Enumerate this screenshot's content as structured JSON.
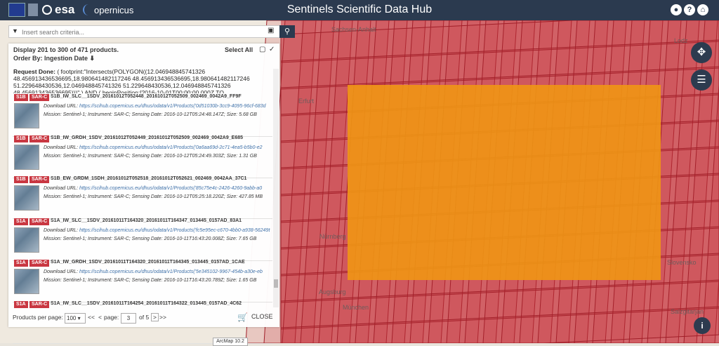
{
  "header": {
    "title": "Sentinels Scientific Data Hub",
    "esa_logo": "esa",
    "copernicus_logo": "opernicus"
  },
  "search": {
    "placeholder": "Insert search criteria..."
  },
  "panel": {
    "summary": "Display 201 to 300 of 471 products.",
    "order_by": "Order By: Ingestion Date",
    "select_all": "Select All",
    "request_label": "Request Done:",
    "request_text": "( footprint:\"Intersects(POLYGON((12.046948845741326 48.456913436536695,18.980641482117246 48.456913436536695,18.980641482117246 51.229648430536,12.046948845741326 51.229648430536,12.046948845741326 48.456913436536695)))\" ) AND ( beginPosition:[2016-10-01T00:00:00.000Z TO"
  },
  "products": [
    {
      "mission_badge": "S1B",
      "type_badge": "SAR-C",
      "name": "S1B_IW_SLC__1SDV_20161012T052448_20161012T052509_002469_0042A9_FF9F",
      "url_label": "Download URL:",
      "url": "https://scihub.copernicus.eu/dhus/odata/v1/Products('0d51030b-3cc9-4095-96cf-683d",
      "details": "Mission: Sentinel-1; Instrument: SAR-C; Sensing Date: 2016-10-12T05:24:48.147Z; Size: 5.68 GB"
    },
    {
      "mission_badge": "S1B",
      "type_badge": "SAR-C",
      "name": "S1B_IW_GRDH_1SDV_20161012T052449_20161012T052509_002469_0042A9_E685",
      "url_label": "Download URL:",
      "url": "https://scihub.copernicus.eu/dhus/odata/v1/Products('0a6aa69d-2c71-4ea5-b5b0-e2",
      "details": "Mission: Sentinel-1; Instrument: SAR-C; Sensing Date: 2016-10-12T05:24:49.303Z; Size: 1.31 GB"
    },
    {
      "mission_badge": "S1B",
      "type_badge": "SAR-C",
      "name": "S1B_EW_GRDM_1SDH_20161012T052518_20161012T052621_002469_0042AA_37C1",
      "url_label": "Download URL:",
      "url": "https://scihub.copernicus.eu/dhus/odata/v1/Products('85c75e4c-2426-4260-9abb-a0",
      "details": "Mission: Sentinel-1; Instrument: SAR-C; Sensing Date: 2016-10-12T05:25:18.220Z; Size: 427.85 MB"
    },
    {
      "mission_badge": "S1A",
      "type_badge": "SAR-C",
      "name": "S1A_IW_SLC__1SDV_20161011T164320_20161011T164347_013445_0157AD_83A1",
      "url_label": "Download URL:",
      "url": "https://scihub.copernicus.eu/dhus/odata/v1/Products('fc5e95ec-c670-4bb0-a938-56249t",
      "details": "Mission: Sentinel-1; Instrument: SAR-C; Sensing Date: 2016-10-11T16:43:20.008Z; Size: 7.65 GB"
    },
    {
      "mission_badge": "S1A",
      "type_badge": "SAR-C",
      "name": "S1A_IW_GRDH_1SDV_20161011T164320_20161011T164345_013445_0157AD_1CAE",
      "url_label": "Download URL:",
      "url": "https://scihub.copernicus.eu/dhus/odata/v1/Products('5e345102-9967-454b-a30e-eb",
      "details": "Mission: Sentinel-1; Instrument: SAR-C; Sensing Date: 2016-10-11T16:43:20.789Z; Size: 1.65 GB"
    },
    {
      "mission_badge": "S1A",
      "type_badge": "SAR-C",
      "name": "S1A_IW_SLC__1SDV_20161011T164254_20161011T164322_013445_0157AD_4C62"
    }
  ],
  "pagination": {
    "per_page_label": "Products per page:",
    "per_page_value": "100",
    "first": "<<",
    "prev": "<",
    "page_label": "page:",
    "page_value": "3",
    "of_label": "of 5",
    "next": ">",
    "last": ">>",
    "close": "CLOSE"
  },
  "map": {
    "labels": [
      "Erfurt",
      "Sachsen-Anhalt",
      "Nürnberg",
      "Augsburg",
      "München",
      "Salzgitarjan",
      "Slovensko",
      "Lodz",
      "Mainz",
      "ArcMap 10.2"
    ],
    "polygon_color": "#c8323c",
    "selection_color": "#f0961a"
  },
  "arcmap_label": "ArcMap 10.2"
}
